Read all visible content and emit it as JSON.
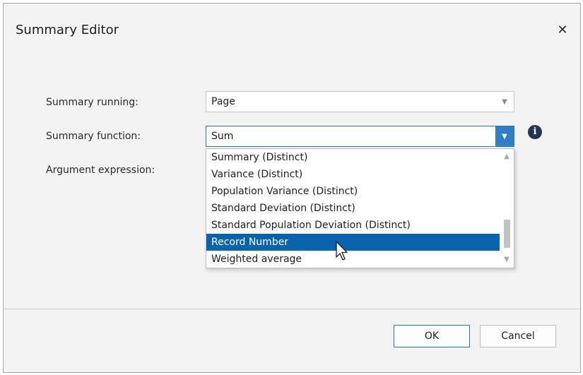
{
  "dialog": {
    "title": "Summary Editor",
    "close_glyph": "✕"
  },
  "fields": {
    "summary_running": {
      "label": "Summary running:",
      "value": "Page"
    },
    "summary_function": {
      "label": "Summary function:",
      "value": "Sum"
    },
    "argument_expression": {
      "label": "Argument expression:"
    }
  },
  "dropdown": {
    "items": [
      "Summary (Distinct)",
      "Variance (Distinct)",
      "Population Variance (Distinct)",
      "Standard Deviation (Distinct)",
      "Standard Population Deviation (Distinct)",
      "Record Number",
      "Weighted average"
    ],
    "selected": "Record Number"
  },
  "icons": {
    "info": "i",
    "dropdown_arrow": "▼",
    "scroll_up": "▲",
    "scroll_down": "▼"
  },
  "colors": {
    "accent": "#2f7fc7",
    "selection": "#0a64ad",
    "info_icon": "#1f3658"
  },
  "buttons": {
    "ok": "OK",
    "cancel": "Cancel"
  }
}
